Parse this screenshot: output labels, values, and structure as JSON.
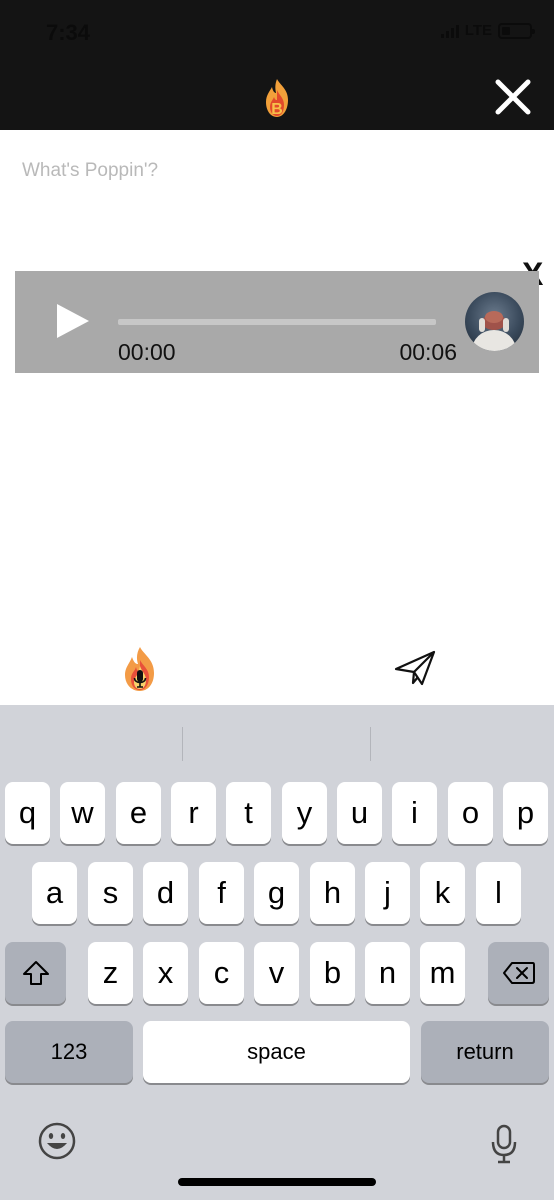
{
  "status_bar": {
    "time": "7:34",
    "network": "LTE"
  },
  "header": {
    "logo_icon": "flame-b-logo-icon",
    "close_icon": "close-x-icon"
  },
  "compose": {
    "placeholder": "What's Poppin'?",
    "remove_label": "X"
  },
  "audio": {
    "current_time": "00:00",
    "duration": "00:06",
    "progress": 0
  },
  "actions": {
    "mic_icon": "fire-mic-icon",
    "send_icon": "paper-plane-icon"
  },
  "keyboard": {
    "row1": [
      "q",
      "w",
      "e",
      "r",
      "t",
      "y",
      "u",
      "i",
      "o",
      "p"
    ],
    "row2": [
      "a",
      "s",
      "d",
      "f",
      "g",
      "h",
      "j",
      "k",
      "l"
    ],
    "row3": [
      "z",
      "x",
      "c",
      "v",
      "b",
      "n",
      "m"
    ],
    "numbers_label": "123",
    "space_label": "space",
    "return_label": "return"
  },
  "colors": {
    "accent_orange": "#f2a03a",
    "accent_red": "#e24a2b",
    "keyboard_bg": "#d1d3d9",
    "audio_card_bg": "#a9a9a9"
  }
}
